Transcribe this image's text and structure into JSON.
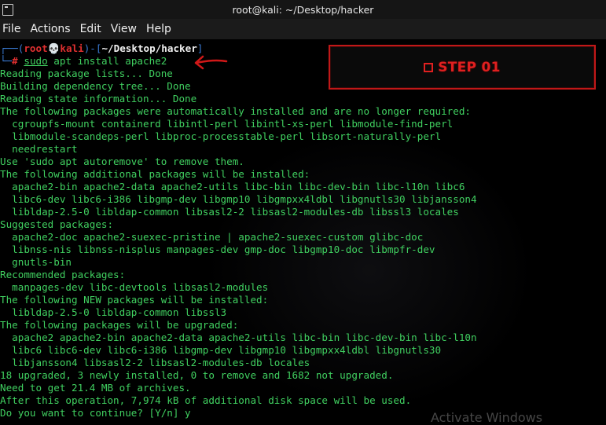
{
  "window": {
    "title": "root@kali: ~/Desktop/hacker"
  },
  "menu": [
    "File",
    "Actions",
    "Edit",
    "View",
    "Help"
  ],
  "prompt": {
    "open": "┌──(",
    "user": "root",
    "skull": "💀",
    "host": "kali",
    "mid": ")-[",
    "path": "~/Desktop/hacker",
    "close": "]",
    "corner": "└─",
    "hash": "#",
    "sudo": "sudo",
    "command_rest": " apt install apache2"
  },
  "output_lines": [
    "Reading package lists... Done",
    "Building dependency tree... Done",
    "Reading state information... Done",
    "The following packages were automatically installed and are no longer required:",
    "  cgroupfs-mount containerd libintl-perl libintl-xs-perl libmodule-find-perl",
    "  libmodule-scandeps-perl libproc-processtable-perl libsort-naturally-perl",
    "  needrestart",
    "Use 'sudo apt autoremove' to remove them.",
    "The following additional packages will be installed:",
    "  apache2-bin apache2-data apache2-utils libc-bin libc-dev-bin libc-l10n libc6",
    "  libc6-dev libc6-i386 libgmp-dev libgmp10 libgmpxx4ldbl libgnutls30 libjansson4",
    "  libldap-2.5-0 libldap-common libsasl2-2 libsasl2-modules-db libssl3 locales",
    "Suggested packages:",
    "  apache2-doc apache2-suexec-pristine | apache2-suexec-custom glibc-doc",
    "  libnss-nis libnss-nisplus manpages-dev gmp-doc libgmp10-doc libmpfr-dev",
    "  gnutls-bin",
    "Recommended packages:",
    "  manpages-dev libc-devtools libsasl2-modules",
    "The following NEW packages will be installed:",
    "  libldap-2.5-0 libldap-common libssl3",
    "The following packages will be upgraded:",
    "  apache2 apache2-bin apache2-data apache2-utils libc-bin libc-dev-bin libc-l10n",
    "  libc6 libc6-dev libc6-i386 libgmp-dev libgmp10 libgmpxx4ldbl libgnutls30",
    "  libjansson4 libsasl2-2 libsasl2-modules-db locales",
    "18 upgraded, 3 newly installed, 0 to remove and 1682 not upgraded.",
    "Need to get 21.4 MB of archives.",
    "After this operation, 7,974 kB of additional disk space will be used.",
    "Do you want to continue? [Y/n] y"
  ],
  "annotation": {
    "label": "STEP 01",
    "color": "#e02020"
  },
  "watermark": "Activate Windows"
}
